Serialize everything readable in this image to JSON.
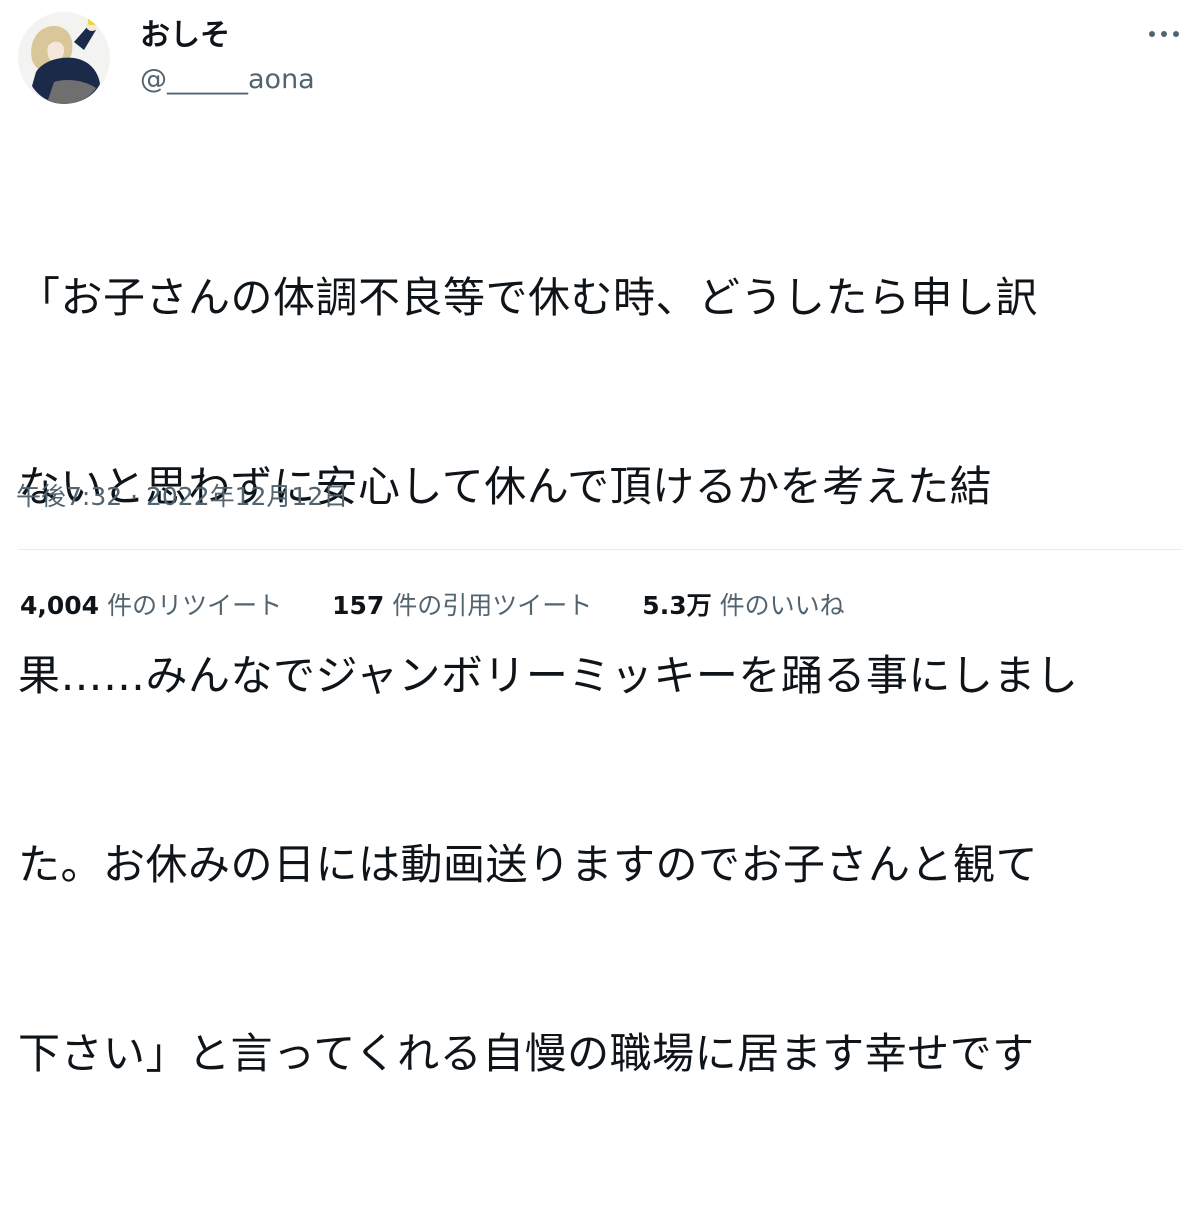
{
  "author": {
    "display_name": "おしそ",
    "handle": "@______aona"
  },
  "tweet": {
    "lines": [
      "「お子さんの体調不良等で休む時、どうしたら申し訳",
      "ないと思わずに安心して休んで頂けるかを考えた結",
      "果……みんなでジャンボリーミッキーを踊る事にしまし",
      "た。お休みの日には動画送りますのでお子さんと観て",
      "下さい」と言ってくれる自慢の職場に居ます幸せです"
    ],
    "timestamp": "午後7:32 · 2022年12月12日"
  },
  "stats": {
    "retweets": {
      "count": "4,004",
      "label": "件のリツイート"
    },
    "quotes": {
      "count": "157",
      "label": "件の引用ツイート"
    },
    "likes": {
      "count": "5.3万",
      "label": "件のいいね"
    }
  },
  "icons": {
    "more": "more-horizontal-icon",
    "avatar": "avatar-illustration"
  },
  "colors": {
    "text_primary": "#0f1419",
    "text_secondary": "#536471",
    "divider": "#e6ecf0"
  }
}
